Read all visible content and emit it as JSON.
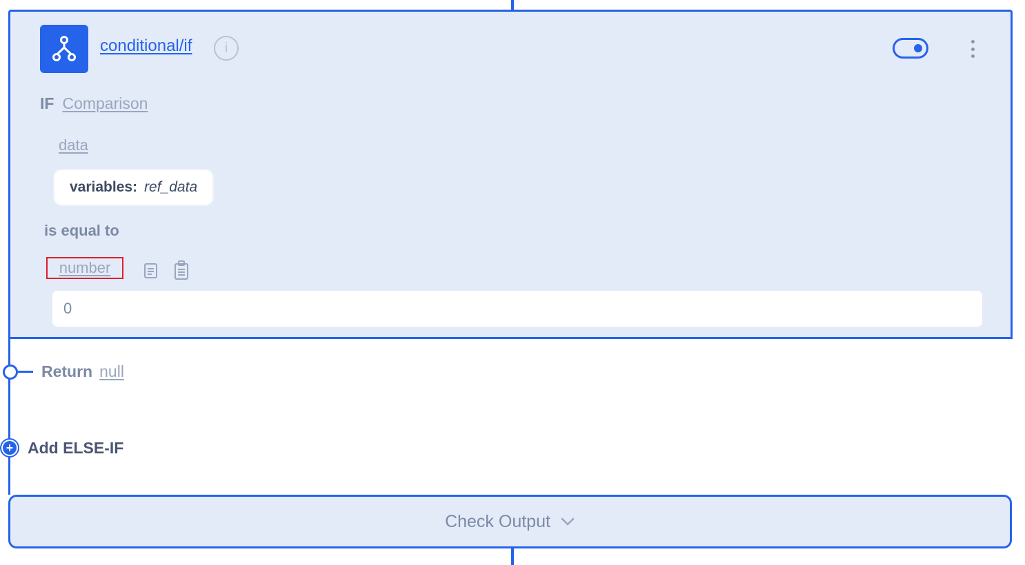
{
  "node": {
    "title": "conditional/if",
    "icon": "branch-icon",
    "enabled": true
  },
  "condition": {
    "keyword": "IF",
    "type_link": "Comparison",
    "left_label": "data",
    "variable_key": "variables:",
    "variable_value": "ref_data",
    "operator": "is equal to",
    "right_label": "number",
    "right_value": "0"
  },
  "return": {
    "keyword": "Return",
    "value": "null"
  },
  "add_else_if": {
    "plus": "+",
    "label": "Add ELSE-IF"
  },
  "check_output": {
    "label": "Check Output"
  },
  "colors": {
    "accent": "#2563eb",
    "card_bg": "#e3ebf8",
    "muted_text": "#7d8aa5",
    "highlight_border": "#e11d2a"
  }
}
